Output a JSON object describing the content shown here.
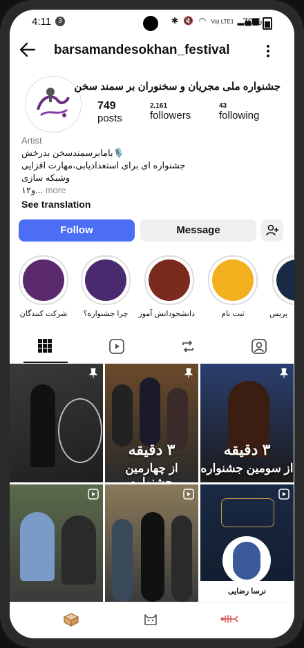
{
  "status": {
    "time": "4:11",
    "notification_count": "3",
    "network": "Vo) LTE1",
    "battery": "70%"
  },
  "profile": {
    "username": "barsamandesokhan_festival",
    "full_name": "جشنواره ملی مجریان و سخنوران بر سمند سخن",
    "posts_count": "749",
    "posts_label": "posts",
    "followers_count": "2,161",
    "followers_label": "followers",
    "following_count": "43",
    "following_label": "following",
    "category": "Artist",
    "bio_line1": "بامابرسمندسخن بدرخش🎙️",
    "bio_line2": "جشنواره ای برای استعدادیابی،مهارت افزایی",
    "bio_line3": "وشبکه سازی",
    "bio_line4": "۱۲و... more",
    "bio_line4_main": "۱۲و...",
    "bio_more": "more",
    "see_translation": "See translation"
  },
  "actions": {
    "follow": "Follow",
    "message": "Message"
  },
  "highlights": [
    {
      "label": "شرکت کنندگان",
      "color": "#5b2a6e"
    },
    {
      "label": "چرا جشنواره؟",
      "color": "#4a2a6e"
    },
    {
      "label": "دانشجودانش آموز",
      "color": "#7a2b1e"
    },
    {
      "label": "ثبت نام",
      "color": "#f2b01e"
    },
    {
      "label": "پریس",
      "color": "#1b2a44"
    }
  ],
  "tabs": [
    "grid-icon",
    "reels-icon",
    "reposts-icon",
    "tagged-icon"
  ],
  "posts": [
    {
      "overlay": "",
      "pinned": true
    },
    {
      "overlay_top": "۳ دقیقه",
      "overlay_bottom": "از چهارمین جشنواره",
      "pinned": true
    },
    {
      "overlay_top": "۳ دقیقه",
      "overlay_bottom": "از سومین جشنواره",
      "pinned": true
    },
    {
      "overlay": "",
      "reel": true
    },
    {
      "overlay": "",
      "reel": true
    },
    {
      "overlay_bottom": "نرسا رضایی",
      "reel": true
    }
  ]
}
